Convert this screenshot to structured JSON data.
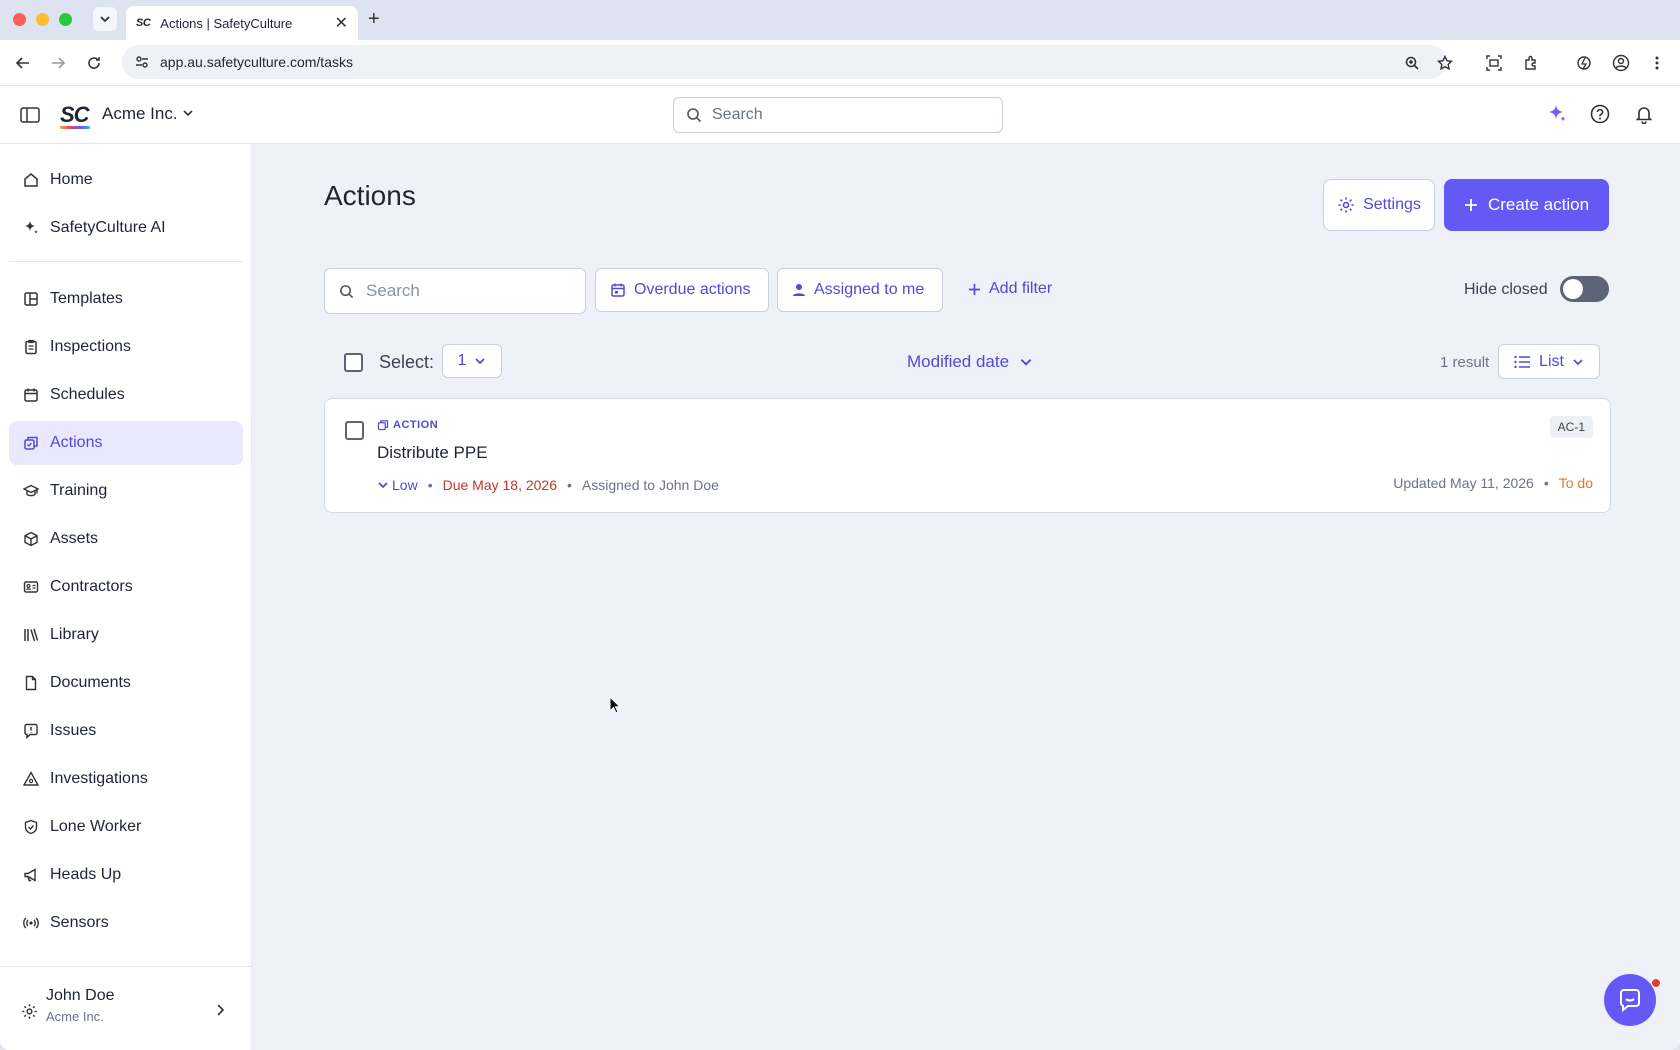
{
  "browser": {
    "tab_title": "Actions | SafetyCulture",
    "tab_favicon": "SC",
    "url": "app.au.safetyculture.com/tasks"
  },
  "header": {
    "logo": "SC",
    "org_name": "Acme Inc.",
    "search_placeholder": "Search"
  },
  "sidebar": {
    "items": [
      {
        "label": "Home",
        "icon": "home-icon"
      },
      {
        "label": "SafetyCulture AI",
        "icon": "sparkle-icon"
      },
      {
        "label": "Templates",
        "icon": "template-icon"
      },
      {
        "label": "Inspections",
        "icon": "clipboard-icon"
      },
      {
        "label": "Schedules",
        "icon": "calendar-icon"
      },
      {
        "label": "Actions",
        "icon": "actions-icon"
      },
      {
        "label": "Training",
        "icon": "graduation-cap-icon"
      },
      {
        "label": "Assets",
        "icon": "cube-icon"
      },
      {
        "label": "Contractors",
        "icon": "id-card-icon"
      },
      {
        "label": "Library",
        "icon": "books-icon"
      },
      {
        "label": "Documents",
        "icon": "document-icon"
      },
      {
        "label": "Issues",
        "icon": "alert-bubble-icon"
      },
      {
        "label": "Investigations",
        "icon": "warning-triangle-icon"
      },
      {
        "label": "Lone Worker",
        "icon": "shield-check-icon"
      },
      {
        "label": "Heads Up",
        "icon": "megaphone-icon"
      },
      {
        "label": "Sensors",
        "icon": "broadcast-icon"
      }
    ],
    "active": "Actions",
    "user": {
      "name": "John Doe",
      "org": "Acme Inc."
    }
  },
  "main": {
    "title": "Actions",
    "settings_label": "Settings",
    "create_label": "Create action",
    "search_placeholder": "Search",
    "filters": {
      "overdue": "Overdue actions",
      "assigned": "Assigned to me",
      "add_filter": "Add filter",
      "hide_closed": "Hide closed",
      "hide_closed_on": false
    },
    "select_label": "Select:",
    "select_value": "1",
    "sort_label": "Modified date",
    "result_count": "1 result",
    "view_label": "List",
    "actions": [
      {
        "type": "ACTION",
        "title": "Distribute PPE",
        "priority": "Low",
        "due": "Due May 18, 2026",
        "assigned": "Assigned to John Doe",
        "id": "AC-1",
        "updated": "Updated May 11, 2026",
        "status": "To do"
      }
    ]
  },
  "colors": {
    "accent": "#6559f6",
    "accent_text": "#5348d8",
    "due": "#c0392b",
    "status_todo": "#e07a1f"
  }
}
